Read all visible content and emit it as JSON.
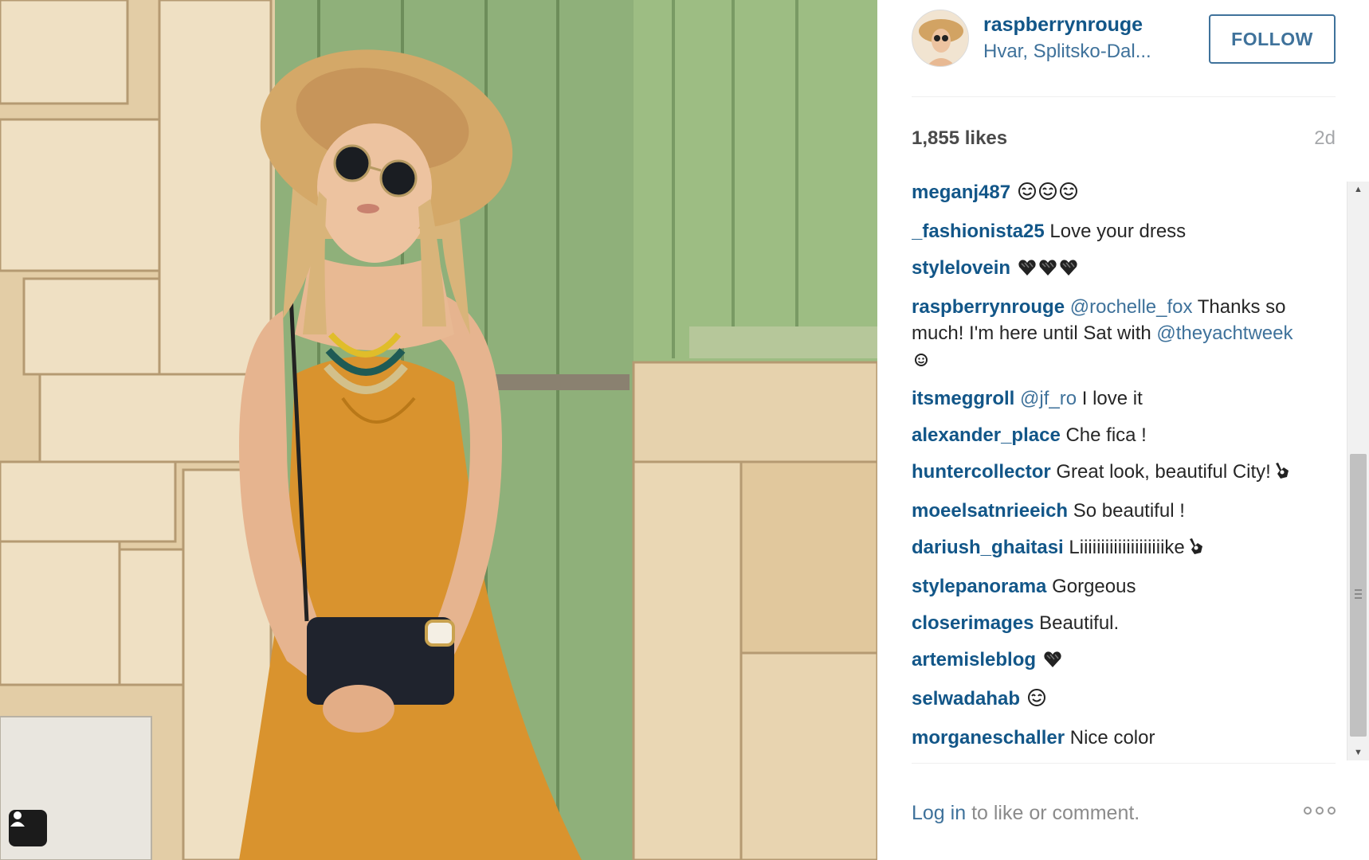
{
  "post": {
    "username": "raspberrynrouge",
    "location": "Hvar, Splitsko-Dal...",
    "follow_label": "FOLLOW",
    "likes": "1,855 likes",
    "time_ago": "2d"
  },
  "comments": [
    {
      "user": "meganj487",
      "text": "",
      "emoji": [
        "smile-eyes-emoji",
        "smile-eyes-emoji",
        "smile-eyes-emoji"
      ]
    },
    {
      "user": "_fashionista25",
      "text": "Love your dress",
      "emoji": []
    },
    {
      "user": "stylelovein",
      "text": "",
      "emoji": [
        "black-heart-emoji",
        "black-heart-emoji",
        "black-heart-emoji"
      ]
    },
    {
      "user": "raspberrynrouge",
      "mention": "@rochelle_fox",
      "text": "Thanks so much! I'm here until Sat with",
      "mention2": "@theyachtweek",
      "emoji": [
        "smiley-emoji"
      ]
    },
    {
      "user": "itsmeggroll",
      "mention": "@jf_ro",
      "text": "I love it",
      "emoji": []
    },
    {
      "user": "alexander_place",
      "text": "Che fica !",
      "emoji": []
    },
    {
      "user": "huntercollector",
      "text": "Great look, beautiful City!",
      "emoji": [
        "ok-hand-emoji"
      ]
    },
    {
      "user": "moeelsatnrieeich",
      "text": "So beautiful !",
      "emoji": []
    },
    {
      "user": "dariush_ghaitasi",
      "text": "Liiiiiiiiiiiiiiiiiiiike",
      "emoji": [
        "ok-hand-emoji"
      ]
    },
    {
      "user": "stylepanorama",
      "text": "Gorgeous",
      "emoji": []
    },
    {
      "user": "closerimages",
      "text": "Beautiful.",
      "emoji": []
    },
    {
      "user": "artemisleblog",
      "text": "",
      "emoji": [
        "black-heart-emoji"
      ]
    },
    {
      "user": "selwadahab",
      "text": "",
      "emoji": [
        "smile-eyes-emoji"
      ]
    },
    {
      "user": "morganeschaller",
      "text": "Nice color",
      "emoji": []
    }
  ],
  "footer": {
    "login_link": "Log in",
    "login_rest": " to like or comment.",
    "more_icon": "ellipsis-icon"
  },
  "colors": {
    "username_blue": "#125688",
    "link_blue": "#3f729b",
    "muted_gray": "#a5a7aa"
  },
  "icons": {
    "tag": "user-tag-icon",
    "scroll_up": "scroll-up-arrow-icon",
    "scroll_down": "scroll-down-arrow-icon"
  }
}
